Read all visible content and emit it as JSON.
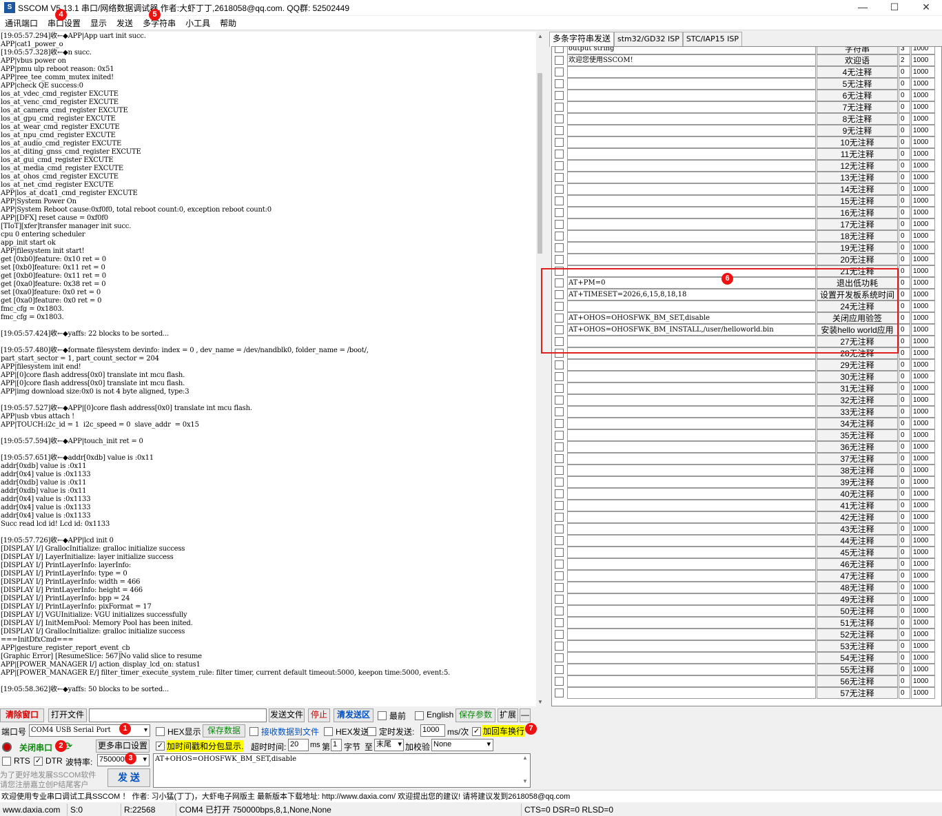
{
  "window": {
    "title": "SSCOM V5.13.1 串口/网络数据调试器,作者:大虾丁丁,2618058@qq.com. QQ群: 52502449",
    "icon": "sscom-logo-icon"
  },
  "menu": [
    "通讯端口",
    "串口设置",
    "显示",
    "发送",
    "多字符串",
    "小工具",
    "帮助"
  ],
  "badges": [
    "1",
    "2",
    "3",
    "4",
    "5",
    "6",
    "7"
  ],
  "log_lines": [
    "[19:05:57.294]收←◆APP|App uart init succ.",
    "APP|cat1_power_o",
    "[19:05:57.328]收←◆n succ.",
    "APP|vbus power on",
    "APP|pmu ulp reboot reason: 0x51",
    "APP|ree_tee_comm_mutex inited!",
    "APP|check QE success:0",
    "los_at_vdec_cmd_register EXCUTE",
    "los_at_venc_cmd_register EXCUTE",
    "los_at_camera_cmd_register EXCUTE",
    "los_at_gpu_cmd_register EXCUTE",
    "los_at_wear_cmd_register EXCUTE",
    "los_at_npu_cmd_register EXCUTE",
    "los_at_audio_cmd_register EXCUTE",
    "los_at_diting_gnss_cmd_register EXCUTE",
    "los_at_gui_cmd_register EXCUTE",
    "los_at_media_cmd_register EXCUTE",
    "los_at_ohos_cmd_register EXCUTE",
    "los_at_net_cmd_register EXCUTE",
    "APP|los_at_dcat1_cmd_register EXCUTE",
    "APP|System Power On",
    "APP|System Reboot cause:0xf0f0, total reboot count:0, exception reboot count:0",
    "APP|[DFX] reset cause = 0xf0f0",
    "[TIoT][xfer]transfer manager init succ.",
    "cpu 0 entering scheduler",
    "app_init start ok",
    "APP|filesystem init start!",
    "get [0xb0]feature: 0x10 ret = 0",
    "set [0xb0]feature: 0x11 ret = 0",
    "get [0xb0]feature: 0x11 ret = 0",
    "get [0xa0]feature: 0x38 ret = 0",
    "set [0xa0]feature: 0x0 ret = 0",
    "get [0xa0]feature: 0x0 ret = 0",
    "fmc_cfg = 0x1803.",
    "fmc_cfg = 0x1803.",
    "",
    "[19:05:57.424]收←◆yaffs: 22 blocks to be sorted...",
    "",
    "[19:05:57.480]收←◆formate filesystem devinfo: index = 0 , dev_name = /dev/nandblk0, folder_name = /boot/,",
    "part_start_sector = 1, part_count_sector = 204",
    "APP|filesystem init end!",
    "APP|[0]core flash address[0x0] translate int mcu flash.",
    "APP|[0]core flash address[0x0] translate int mcu flash.",
    "APP|img download size:0x0 is not 4 byte aligned, type:3",
    "",
    "[19:05:57.527]收←◆APP|[0]core flash address[0x0] translate int mcu flash.",
    "APP|usb vbus attach !",
    "APP|TOUCH:i2c_id = 1  i2c_speed = 0  slave_addr  = 0x15",
    "",
    "[19:05:57.594]收←◆APP|touch_init ret = 0",
    "",
    "[19:05:57.651]收←◆addr[0xdb] value is :0x11",
    "addr[0xdb] value is :0x11",
    "addr[0x4] value is :0x1133",
    "addr[0xdb] value is :0x11",
    "addr[0xdb] value is :0x11",
    "addr[0x4] value is :0x1133",
    "addr[0x4] value is :0x1133",
    "addr[0x4] value is :0x1133",
    "Succ read lcd id! Lcd id: 0x1133",
    "",
    "[19:05:57.726]收←◆APP|lcd init 0",
    "[DISPLAY I/] GrallocInitialize: gralloc initialize success",
    "[DISPLAY I/] LayerInitialize: layer initialize success",
    "[DISPLAY I/] PrintLayerInfo: layerInfo:",
    "[DISPLAY I/] PrintLayerInfo: type = 0",
    "[DISPLAY I/] PrintLayerInfo: width = 466",
    "[DISPLAY I/] PrintLayerInfo: height = 466",
    "[DISPLAY I/] PrintLayerInfo: bpp = 24",
    "[DISPLAY I/] PrintLayerInfo: pixFormat = 17",
    "[DISPLAY I/] VGUInitialize: VGU initializes successfully",
    "[DISPLAY I/] InitMemPool: Memory Pool has been inited.",
    "[DISPLAY I/] GrallocInitialize: gralloc initialize success",
    "===InitDfxCmd===",
    "APP|gesture_register_report_event_cb",
    "[Graphic Error] [ResumeSlice: 567]No valid slice to resume",
    "APP|[POWER_MANAGER I/] action_display_lcd_on: status1",
    "APP|[POWER_MANAGER E/] filter_timer_execute_system_rule: filter timer, current default timeout:5000, keepon time:5000, event:5.",
    "",
    "[19:05:58.362]收←◆yaffs: 50 blocks to be sorted..."
  ],
  "right_panel": {
    "tabs": [
      "多条字符串发送",
      "stm32/GD32 ISP",
      "STC/IAP15 ISP"
    ],
    "rows": [
      {
        "text": "output string",
        "btn": "字符串",
        "n": "3",
        "delay": "1000"
      },
      {
        "text": "欢迎您使用SSCOM!",
        "btn": "欢迎语",
        "n": "2",
        "delay": "1000"
      },
      {
        "text": "",
        "btn": "4无注释",
        "n": "0",
        "delay": "1000"
      },
      {
        "text": "",
        "btn": "5无注释",
        "n": "0",
        "delay": "1000"
      },
      {
        "text": "",
        "btn": "6无注释",
        "n": "0",
        "delay": "1000"
      },
      {
        "text": "",
        "btn": "7无注释",
        "n": "0",
        "delay": "1000"
      },
      {
        "text": "",
        "btn": "8无注释",
        "n": "0",
        "delay": "1000"
      },
      {
        "text": "",
        "btn": "9无注释",
        "n": "0",
        "delay": "1000"
      },
      {
        "text": "",
        "btn": "10无注释",
        "n": "0",
        "delay": "1000"
      },
      {
        "text": "",
        "btn": "11无注释",
        "n": "0",
        "delay": "1000"
      },
      {
        "text": "",
        "btn": "12无注释",
        "n": "0",
        "delay": "1000"
      },
      {
        "text": "",
        "btn": "13无注释",
        "n": "0",
        "delay": "1000"
      },
      {
        "text": "",
        "btn": "14无注释",
        "n": "0",
        "delay": "1000"
      },
      {
        "text": "",
        "btn": "15无注释",
        "n": "0",
        "delay": "1000"
      },
      {
        "text": "",
        "btn": "16无注释",
        "n": "0",
        "delay": "1000"
      },
      {
        "text": "",
        "btn": "17无注释",
        "n": "0",
        "delay": "1000"
      },
      {
        "text": "",
        "btn": "18无注释",
        "n": "0",
        "delay": "1000"
      },
      {
        "text": "",
        "btn": "19无注释",
        "n": "0",
        "delay": "1000"
      },
      {
        "text": "",
        "btn": "20无注释",
        "n": "0",
        "delay": "1000"
      },
      {
        "text": "",
        "btn": "21无注释",
        "n": "0",
        "delay": "1000"
      },
      {
        "text": "AT+PM=0",
        "btn": "退出低功耗",
        "n": "0",
        "delay": "1000"
      },
      {
        "text": "AT+TIMESET=2026,6,15,8,18,18",
        "btn": "设置开发板系统时间",
        "n": "0",
        "delay": "1000"
      },
      {
        "text": "",
        "btn": "24无注释",
        "n": "0",
        "delay": "1000"
      },
      {
        "text": "AT+OHOS=OHOSFWK_BM_SET,disable",
        "btn": "关闭应用验签",
        "n": "0",
        "delay": "1000"
      },
      {
        "text": "AT+OHOS=OHOSFWK_BM_INSTALL,/user/helloworld.bin",
        "btn": "安装hello world应用",
        "n": "0",
        "delay": "1000"
      },
      {
        "text": "",
        "btn": "27无注释",
        "n": "0",
        "delay": "1000"
      },
      {
        "text": "",
        "btn": "28无注释",
        "n": "0",
        "delay": "1000"
      },
      {
        "text": "",
        "btn": "29无注释",
        "n": "0",
        "delay": "1000"
      },
      {
        "text": "",
        "btn": "30无注释",
        "n": "0",
        "delay": "1000"
      },
      {
        "text": "",
        "btn": "31无注释",
        "n": "0",
        "delay": "1000"
      },
      {
        "text": "",
        "btn": "32无注释",
        "n": "0",
        "delay": "1000"
      },
      {
        "text": "",
        "btn": "33无注释",
        "n": "0",
        "delay": "1000"
      },
      {
        "text": "",
        "btn": "34无注释",
        "n": "0",
        "delay": "1000"
      },
      {
        "text": "",
        "btn": "35无注释",
        "n": "0",
        "delay": "1000"
      },
      {
        "text": "",
        "btn": "36无注释",
        "n": "0",
        "delay": "1000"
      },
      {
        "text": "",
        "btn": "37无注释",
        "n": "0",
        "delay": "1000"
      },
      {
        "text": "",
        "btn": "38无注释",
        "n": "0",
        "delay": "1000"
      },
      {
        "text": "",
        "btn": "39无注释",
        "n": "0",
        "delay": "1000"
      },
      {
        "text": "",
        "btn": "40无注释",
        "n": "0",
        "delay": "1000"
      },
      {
        "text": "",
        "btn": "41无注释",
        "n": "0",
        "delay": "1000"
      },
      {
        "text": "",
        "btn": "42无注释",
        "n": "0",
        "delay": "1000"
      },
      {
        "text": "",
        "btn": "43无注释",
        "n": "0",
        "delay": "1000"
      },
      {
        "text": "",
        "btn": "44无注释",
        "n": "0",
        "delay": "1000"
      },
      {
        "text": "",
        "btn": "45无注释",
        "n": "0",
        "delay": "1000"
      },
      {
        "text": "",
        "btn": "46无注释",
        "n": "0",
        "delay": "1000"
      },
      {
        "text": "",
        "btn": "47无注释",
        "n": "0",
        "delay": "1000"
      },
      {
        "text": "",
        "btn": "48无注释",
        "n": "0",
        "delay": "1000"
      },
      {
        "text": "",
        "btn": "49无注释",
        "n": "0",
        "delay": "1000"
      },
      {
        "text": "",
        "btn": "50无注释",
        "n": "0",
        "delay": "1000"
      },
      {
        "text": "",
        "btn": "51无注释",
        "n": "0",
        "delay": "1000"
      },
      {
        "text": "",
        "btn": "52无注释",
        "n": "0",
        "delay": "1000"
      },
      {
        "text": "",
        "btn": "53无注释",
        "n": "0",
        "delay": "1000"
      },
      {
        "text": "",
        "btn": "54无注释",
        "n": "0",
        "delay": "1000"
      },
      {
        "text": "",
        "btn": "55无注释",
        "n": "0",
        "delay": "1000"
      },
      {
        "text": "",
        "btn": "56无注释",
        "n": "0",
        "delay": "1000"
      },
      {
        "text": "",
        "btn": "57无注释",
        "n": "0",
        "delay": "1000"
      }
    ]
  },
  "toolbar": {
    "clear": "清除窗口",
    "open_file": "打开文件",
    "send_file": "发送文件",
    "stop": "停止",
    "clear_send": "清发送区",
    "topmost": "最前",
    "english": "English",
    "save_params": "保存参数",
    "expand": "扩展",
    "minus": "—"
  },
  "port": {
    "port_label": "端口号",
    "port_value": "COM4 USB Serial Port",
    "hex_display": "HEX显示",
    "save_data": "保存数据",
    "recv_to_file": "接收数据到文件",
    "hex_send": "HEX发送",
    "timed_send": "定时发送:",
    "interval": "1000",
    "interval_unit": "ms/次",
    "crlf": "加回车换行",
    "close_port": "关闭串口",
    "more_settings": "更多串口设置",
    "timestamp": "加时间戳和分包显示.",
    "timeout_label": "超时时间:",
    "timeout": "20",
    "timeout_unit": "ms",
    "frame_prefix": "第",
    "frame_num": "1",
    "frame_bytes": "字节",
    "frame_to": "至",
    "frame_end": "末尾",
    "checksum_label": "加校验",
    "checksum": "None",
    "rts": "RTS",
    "dtr": "DTR",
    "baud_label": "波特率:",
    "baud": "750000",
    "send_text": "AT+OHOS=OHOSFWK_BM_SET,disable",
    "promo1": "为了更好地发展SSCOM软件",
    "promo2": "请您注册嘉立创P结尾客户",
    "send": "发 送"
  },
  "status": {
    "banner": "欢迎使用专业串口调试工具SSCOM ！  作者: 习小猛(丁丁)，大虾电子网版主  最新版本下载地址: http://www.daxia.com/  欢迎提出您的建议! 请将建议发到2618058@qq.com",
    "site": "www.daxia.com",
    "sent": "S:0",
    "recv": "R:22568",
    "port_state": "COM4 已打开  750000bps,8,1,None,None",
    "lines": "CTS=0 DSR=0 RLSD=0"
  }
}
